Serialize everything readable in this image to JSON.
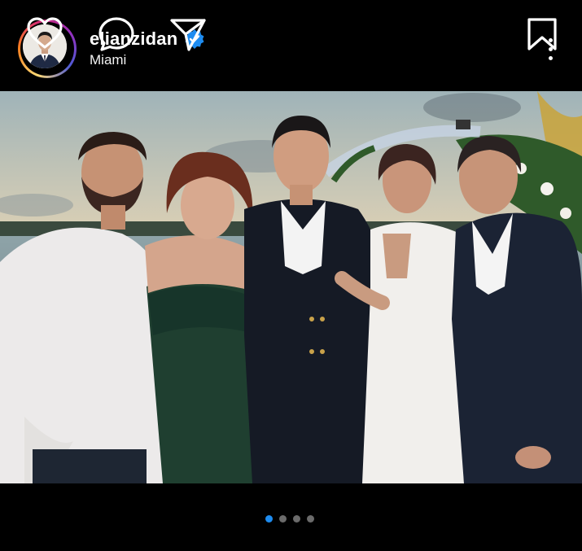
{
  "post": {
    "username": "elianzidan",
    "verified": true,
    "location": "Miami"
  },
  "icons": {
    "menu": "more-vertical-icon",
    "like": "heart-icon",
    "comment": "comment-bubble-icon",
    "share": "paper-plane-icon",
    "save": "bookmark-icon"
  },
  "carousel": {
    "total": 4,
    "active": 1
  },
  "colors": {
    "background": "#000000",
    "verified_badge": "#1e8cf0",
    "active_dot": "#1e8cf0",
    "inactive_dot": "#6b6b6b"
  }
}
